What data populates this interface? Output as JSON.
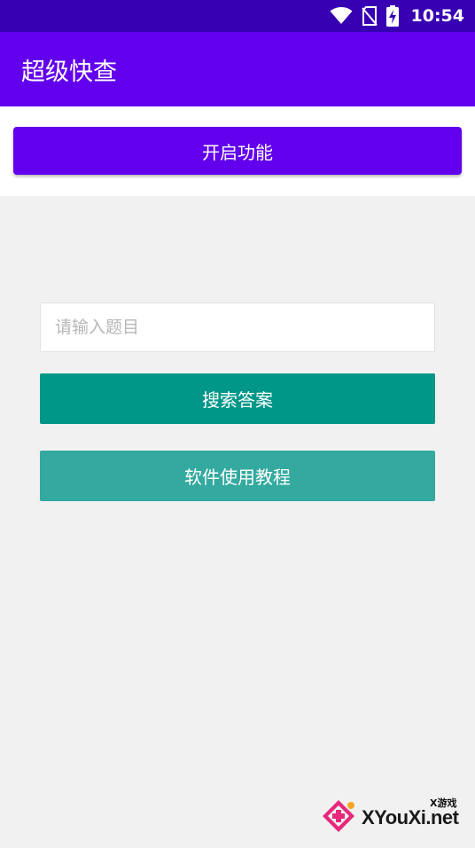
{
  "status_bar": {
    "time": "10:54",
    "icons": [
      "wifi-icon",
      "no-sim-icon",
      "battery-charging-icon"
    ]
  },
  "app_bar": {
    "title": "超级快查"
  },
  "top_panel": {
    "enable_button_label": "开启功能"
  },
  "search": {
    "input_value": "",
    "input_placeholder": "请输入题目",
    "search_button_label": "搜索答案",
    "tutorial_button_label": "软件使用教程"
  },
  "watermark": {
    "small_text": "X游戏",
    "main_text": "XYouXi.net"
  },
  "colors": {
    "status_bar": "#3700b3",
    "primary": "#6200ee",
    "search_button": "#009688",
    "tutorial_button": "#33a99f",
    "background": "#f1f1f1"
  }
}
